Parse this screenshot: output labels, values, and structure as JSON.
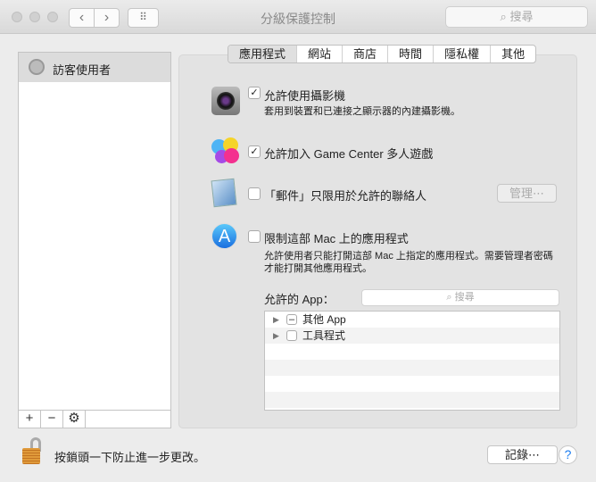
{
  "window": {
    "title": "分級保護控制",
    "search_placeholder": "搜尋",
    "back": "‹",
    "forward": "›",
    "grid": "⠿"
  },
  "sidebar": {
    "users": [
      {
        "label": "訪客使用者"
      }
    ],
    "add": "+",
    "remove": "−",
    "gear": "⚙"
  },
  "tabs": [
    {
      "label": "應用程式",
      "selected": true
    },
    {
      "label": "網站"
    },
    {
      "label": "商店"
    },
    {
      "label": "時間"
    },
    {
      "label": "隱私權"
    },
    {
      "label": "其他"
    }
  ],
  "options": {
    "camera": {
      "label": "允許使用攝影機",
      "checked": true,
      "description": "套用到裝置和已連接之顯示器的內建攝影機。"
    },
    "game_center": {
      "label": "允許加入 Game Center 多人遊戲",
      "checked": true
    },
    "mail": {
      "label": "「郵件」只限用於允許的聯絡人",
      "checked": false,
      "manage_button": "管理⋯"
    },
    "limit_apps": {
      "label": "限制這部 Mac 上的應用程式",
      "checked": false,
      "description_line1": "允許使用者只能打開這部 Mac 上指定的應用程式。需要管理者密碼",
      "description_line2": "才能打開其他應用程式。"
    }
  },
  "allowed_apps": {
    "label": "允許的 App：",
    "search_placeholder": "搜尋",
    "items": [
      {
        "label": "其他 App",
        "state": "mixed"
      },
      {
        "label": "工具程式",
        "state": "unchecked"
      }
    ]
  },
  "footer": {
    "lock_text": "按鎖頭一下防止進一步更改。",
    "logs_button": "記錄⋯",
    "help": "?"
  },
  "check_mark": "✓",
  "mixed_mark": "–",
  "search_icon": "⌕"
}
